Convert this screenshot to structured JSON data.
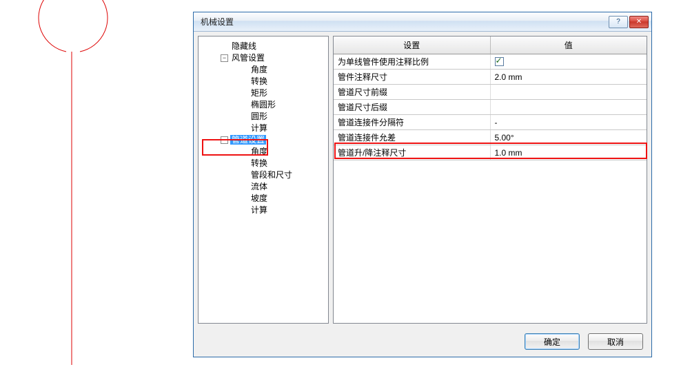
{
  "dialog": {
    "title": "机械设置",
    "help_label": "?",
    "close_label": "✕",
    "ok_label": "确定",
    "cancel_label": "取消"
  },
  "tree": {
    "items": [
      {
        "label": "隐藏线",
        "depth": 1,
        "expander": ""
      },
      {
        "label": "风管设置",
        "depth": 1,
        "expander": "-"
      },
      {
        "label": "角度",
        "depth": 2,
        "expander": ""
      },
      {
        "label": "转换",
        "depth": 2,
        "expander": ""
      },
      {
        "label": "矩形",
        "depth": 2,
        "expander": ""
      },
      {
        "label": "椭圆形",
        "depth": 2,
        "expander": ""
      },
      {
        "label": "圆形",
        "depth": 2,
        "expander": ""
      },
      {
        "label": "计算",
        "depth": 2,
        "expander": ""
      },
      {
        "label": "管道设置",
        "depth": 1,
        "expander": "-",
        "selected": true
      },
      {
        "label": "角度",
        "depth": 2,
        "expander": ""
      },
      {
        "label": "转换",
        "depth": 2,
        "expander": ""
      },
      {
        "label": "管段和尺寸",
        "depth": 2,
        "expander": ""
      },
      {
        "label": "流体",
        "depth": 2,
        "expander": ""
      },
      {
        "label": "坡度",
        "depth": 2,
        "expander": ""
      },
      {
        "label": "计算",
        "depth": 2,
        "expander": ""
      }
    ]
  },
  "grid": {
    "headers": {
      "setting": "设置",
      "value": "值"
    },
    "rows": [
      {
        "setting": "为单线管件使用注释比例",
        "value": "",
        "checkbox": true,
        "checked": true
      },
      {
        "setting": "管件注释尺寸",
        "value": "2.0 mm"
      },
      {
        "setting": "管道尺寸前缀",
        "value": ""
      },
      {
        "setting": "管道尺寸后缀",
        "value": ""
      },
      {
        "setting": "管道连接件分隔符",
        "value": "-"
      },
      {
        "setting": "管道连接件允差",
        "value": "5.00°"
      },
      {
        "setting": "管道升/降注释尺寸",
        "value": "1.0 mm",
        "highlight": true
      }
    ]
  }
}
